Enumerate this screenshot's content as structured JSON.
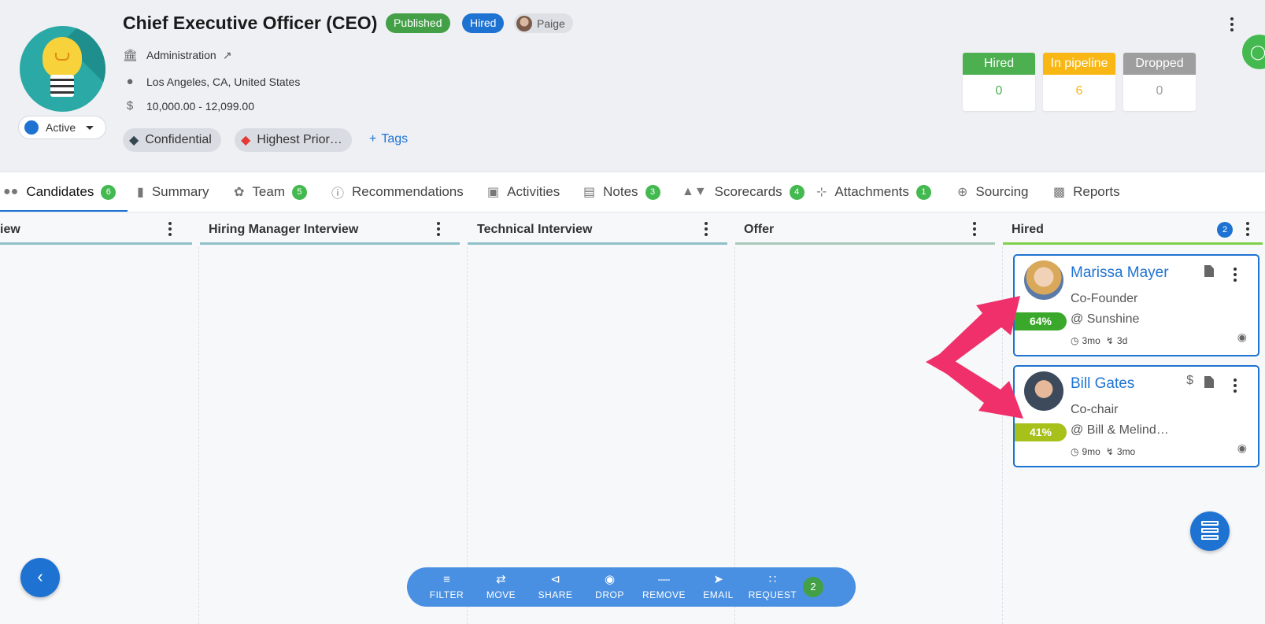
{
  "job": {
    "title": "Chief Executive Officer (CEO)",
    "badges": {
      "published": "Published",
      "hired": "Hired"
    },
    "owner": "Paige",
    "department": "Administration",
    "location": "Los Angeles, CA, United States",
    "salary": "10,000.00 - 12,099.00",
    "status": "Active",
    "tags": [
      "Confidential",
      "Highest Prior…"
    ],
    "add_tags_label": "Tags",
    "add_tags_icon": "plus-icon"
  },
  "stats": [
    {
      "label": "Hired",
      "value": "0",
      "color": "#4caf50"
    },
    {
      "label": "In pipeline",
      "value": "6",
      "color": "#f9b715"
    },
    {
      "label": "Dropped",
      "value": "0",
      "color": "#9e9e9e"
    }
  ],
  "tabs": [
    {
      "label": "Candidates",
      "icon": "people-icon",
      "badge": "6"
    },
    {
      "label": "Summary",
      "icon": "book-icon"
    },
    {
      "label": "Team",
      "icon": "team-icon",
      "badge": "5"
    },
    {
      "label": "Recommendations",
      "icon": "info-icon"
    },
    {
      "label": "Activities",
      "icon": "calendar-icon"
    },
    {
      "label": "Notes",
      "icon": "note-icon",
      "badge": "3"
    },
    {
      "label": "Scorecards",
      "icon": "thumbs-icon",
      "badge": "4"
    },
    {
      "label": "Attachments",
      "icon": "paperclip-icon",
      "badge": "1"
    },
    {
      "label": "Sourcing",
      "icon": "sourcing-icon"
    },
    {
      "label": "Reports",
      "icon": "reports-icon"
    }
  ],
  "columns": [
    {
      "name": "iew"
    },
    {
      "name": "Hiring Manager Interview"
    },
    {
      "name": "Technical Interview"
    },
    {
      "name": "Offer"
    },
    {
      "name": "Hired",
      "count": "2"
    }
  ],
  "candidates": [
    {
      "name": "Marissa Mayer",
      "role": "Co-Founder",
      "company": "@ Sunshine",
      "score": "64%",
      "score_color": "#3aa82a",
      "age": "3mo",
      "activity": "3d"
    },
    {
      "name": "Bill Gates",
      "role": "Co-chair",
      "company": "@ Bill & Melind…",
      "score": "41%",
      "score_color": "#a8c11a",
      "age": "9mo",
      "activity": "3mo"
    }
  ],
  "toolbar": {
    "items": [
      {
        "label": "FILTER",
        "icon": "filter-icon"
      },
      {
        "label": "MOVE",
        "icon": "move-icon"
      },
      {
        "label": "SHARE",
        "icon": "share-icon"
      },
      {
        "label": "DROP",
        "icon": "drop-icon"
      },
      {
        "label": "REMOVE",
        "icon": "remove-icon"
      },
      {
        "label": "EMAIL",
        "icon": "send-icon"
      },
      {
        "label": "REQUEST",
        "icon": "request-icon"
      }
    ],
    "selected_count": "2"
  },
  "colors": {
    "accent": "#1e73d2",
    "arrow": "#f0306a"
  }
}
